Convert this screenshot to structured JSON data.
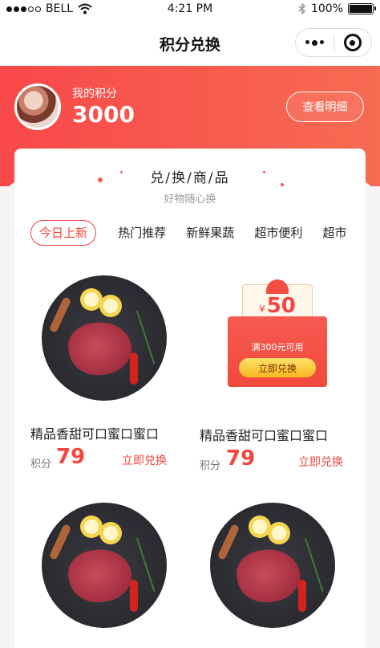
{
  "status_bar": {
    "carrier": "BELL",
    "time": "4:21 PM",
    "battery": "100%",
    "battery_level": 1.0
  },
  "nav": {
    "title": "积分兑换"
  },
  "header": {
    "points_label": "我的积分",
    "points_value": "3000",
    "detail_button": "查看明细"
  },
  "section": {
    "title": "兑/换/商/品",
    "subtitle": "好物随心换"
  },
  "tabs": [
    {
      "label": "今日上新",
      "active": true
    },
    {
      "label": "热门推荐",
      "active": false
    },
    {
      "label": "新鲜果蔬",
      "active": false
    },
    {
      "label": "超市便利",
      "active": false
    },
    {
      "label": "超市",
      "active": false
    }
  ],
  "products": [
    {
      "name": "精品香甜可口蜜口蜜口",
      "points_label": "积分",
      "points": "79",
      "button": "立即兑换"
    },
    {
      "name": "精品香甜可口蜜口蜜口",
      "points_label": "积分",
      "points": "79",
      "button": "立即兑换"
    }
  ],
  "coupon": {
    "currency": "¥",
    "amount": "50",
    "condition": "满300元可用",
    "button": "立即兑换"
  },
  "colors": {
    "accent": "#f5443d",
    "header_gradient_start": "#f9484a",
    "header_gradient_end": "#f76b52"
  }
}
